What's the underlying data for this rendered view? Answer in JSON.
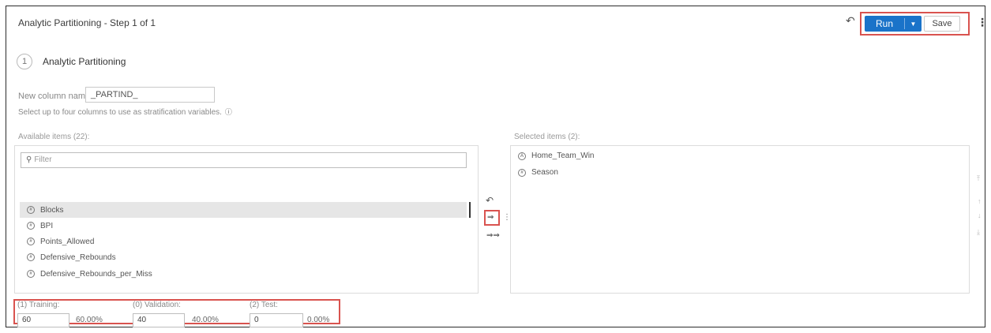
{
  "header": {
    "title": "Analytic Partitioning - Step 1 of 1",
    "undo_icon": "undo-icon",
    "run_label": "Run",
    "run_dropdown_icon": "caret-down-icon",
    "save_label": "Save",
    "more_icon": "vertical-ellipsis-icon"
  },
  "step": {
    "number": "1",
    "title": "Analytic Partitioning"
  },
  "column_name": {
    "label": "New column name:",
    "value": "_PARTIND_"
  },
  "hint": {
    "text": "Select up to four columns to use as stratification variables.",
    "help_icon": "help-icon"
  },
  "available": {
    "label": "Available items (22):",
    "filter_placeholder": "Filter",
    "items": [
      {
        "label": "Blocks",
        "icon": "numeric-icon",
        "selected": true
      },
      {
        "label": "BPI",
        "icon": "numeric-icon",
        "selected": false
      },
      {
        "label": "Points_Allowed",
        "icon": "numeric-icon",
        "selected": false
      },
      {
        "label": "Defensive_Rebounds",
        "icon": "numeric-icon",
        "selected": false
      },
      {
        "label": "Defensive_Rebounds_per_Miss",
        "icon": "numeric-icon",
        "selected": false
      }
    ]
  },
  "selected": {
    "label": "Selected items (2):",
    "items": [
      {
        "label": "Home_Team_Win",
        "icon": "character-icon"
      },
      {
        "label": "Season",
        "icon": "numeric-icon"
      }
    ]
  },
  "partitions": {
    "training": {
      "label": "(1) Training:",
      "value": "60",
      "percent": "60.00%"
    },
    "validation": {
      "label": "(0) Validation:",
      "value": "40",
      "percent": "40.00%"
    },
    "test": {
      "label": "(2) Test:",
      "value": "0",
      "percent": "0.00%"
    }
  },
  "colors": {
    "accent": "#1a73c9",
    "highlight": "#d9534f"
  }
}
